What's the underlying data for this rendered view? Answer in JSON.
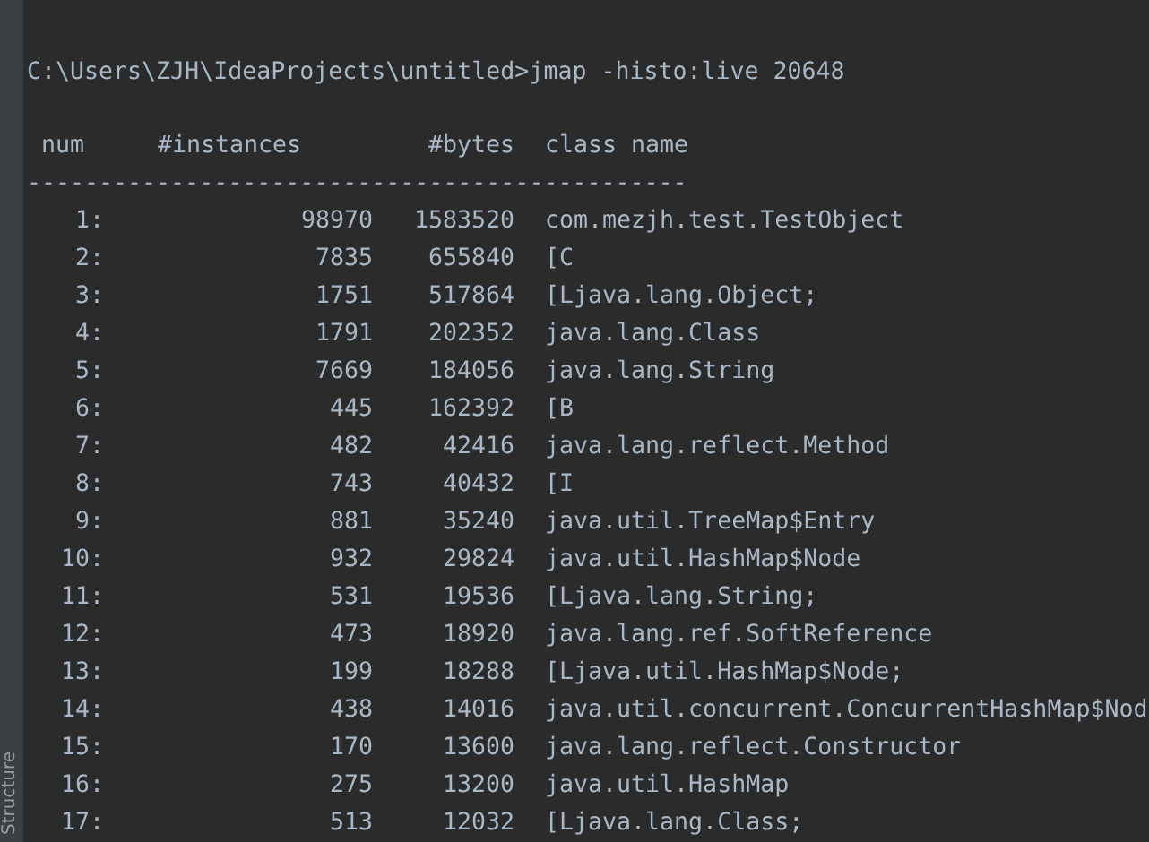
{
  "side_tab": {
    "label": "Structure"
  },
  "command": "C:\\Users\\ZJH\\IdeaProjects\\untitled>jmap -histo:live 20648",
  "table": {
    "columns": [
      "num",
      "#instances",
      "#bytes",
      "class name"
    ],
    "separator": "----------------------------------------------",
    "rows": [
      [
        "1:",
        "98970",
        "1583520",
        "com.mezjh.test.TestObject"
      ],
      [
        "2:",
        "7835",
        "655840",
        "[C"
      ],
      [
        "3:",
        "1751",
        "517864",
        "[Ljava.lang.Object;"
      ],
      [
        "4:",
        "1791",
        "202352",
        "java.lang.Class"
      ],
      [
        "5:",
        "7669",
        "184056",
        "java.lang.String"
      ],
      [
        "6:",
        "445",
        "162392",
        "[B"
      ],
      [
        "7:",
        "482",
        "42416",
        "java.lang.reflect.Method"
      ],
      [
        "8:",
        "743",
        "40432",
        "[I"
      ],
      [
        "9:",
        "881",
        "35240",
        "java.util.TreeMap$Entry"
      ],
      [
        "10:",
        "932",
        "29824",
        "java.util.HashMap$Node"
      ],
      [
        "11:",
        "531",
        "19536",
        "[Ljava.lang.String;"
      ],
      [
        "12:",
        "473",
        "18920",
        "java.lang.ref.SoftReference"
      ],
      [
        "13:",
        "199",
        "18288",
        "[Ljava.util.HashMap$Node;"
      ],
      [
        "14:",
        "438",
        "14016",
        "java.util.concurrent.ConcurrentHashMap$Nod"
      ],
      [
        "15:",
        "170",
        "13600",
        "java.lang.reflect.Constructor"
      ],
      [
        "16:",
        "275",
        "13200",
        "java.util.HashMap"
      ],
      [
        "17:",
        "513",
        "12032",
        "[Ljava.lang.Class;"
      ]
    ]
  }
}
